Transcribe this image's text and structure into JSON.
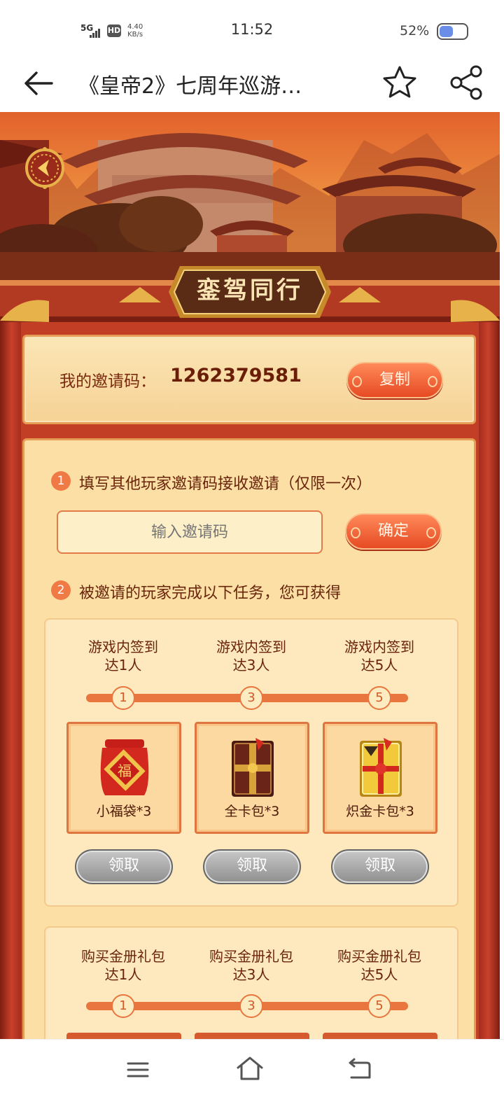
{
  "status_bar": {
    "network": "5G",
    "hd_badge": "HD",
    "speed_value": "4.40",
    "speed_unit": "KB/s",
    "time": "11:52",
    "battery_percent": "52%",
    "battery_level": 0.52
  },
  "title_bar": {
    "title": "《皇帝2》七周年巡游…"
  },
  "banner": {
    "title": "銮驾同行"
  },
  "invite": {
    "label": "我的邀请码：",
    "code": "1262379581",
    "copy_label": "复制"
  },
  "step1": {
    "number": "1",
    "text": "填写其他玩家邀请码接收邀请（仅限一次）",
    "input_placeholder": "输入邀请码",
    "input_value": "",
    "confirm_label": "确定"
  },
  "step2": {
    "number": "2",
    "text": "被邀请的玩家完成以下任务，您可获得"
  },
  "task_groups": [
    {
      "milestones": [
        {
          "label_line1": "游戏内签到",
          "label_line2": "达1人",
          "node": "1",
          "reward": "小福袋*3",
          "reward_icon": "lucky-bag-icon",
          "claim_label": "领取"
        },
        {
          "label_line1": "游戏内签到",
          "label_line2": "达3人",
          "node": "3",
          "reward": "全卡包*3",
          "reward_icon": "card-pack-icon",
          "claim_label": "领取"
        },
        {
          "label_line1": "游戏内签到",
          "label_line2": "达5人",
          "node": "5",
          "reward": "炽金卡包*3",
          "reward_icon": "gold-card-pack-icon",
          "claim_label": "领取"
        }
      ]
    },
    {
      "milestones": [
        {
          "label_line1": "购买金册礼包",
          "label_line2": "达1人",
          "node": "1"
        },
        {
          "label_line1": "购买金册礼包",
          "label_line2": "达3人",
          "node": "3"
        },
        {
          "label_line1": "购买金册礼包",
          "label_line2": "达5人",
          "node": "5"
        }
      ]
    }
  ],
  "colors": {
    "accent_red": "#e64a23",
    "panel_cream": "#fbdfa4",
    "text_brown": "#6a240c",
    "disabled_gray": "#8e8e8e"
  }
}
